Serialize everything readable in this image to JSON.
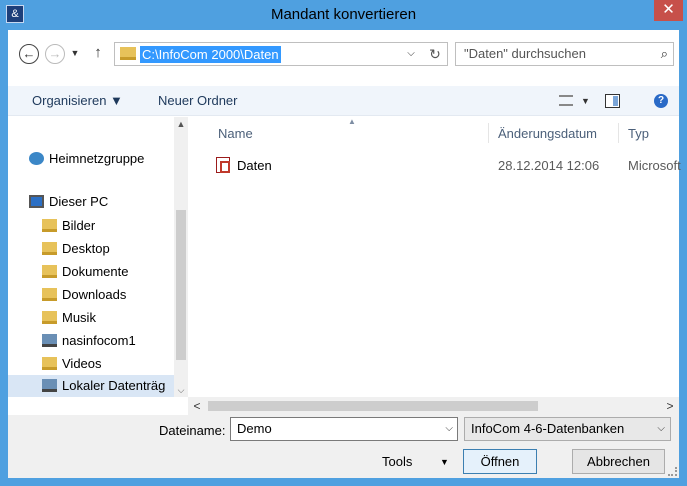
{
  "window": {
    "title": "Mandant konvertieren",
    "app_icon": "infocom-app-icon",
    "close": "✕"
  },
  "nav": {
    "back": "←",
    "forward": "→",
    "recent": "▼",
    "up": "↑",
    "address": "C:\\InfoCom 2000\\Daten",
    "address_dropdown": "⌵",
    "refresh": "↻",
    "search_placeholder": "\"Daten\" durchsuchen",
    "search_icon": "⌕"
  },
  "toolbar": {
    "organize": "Organisieren ▼",
    "new_folder": "Neuer Ordner",
    "view_dropdown": "▼",
    "help": "?"
  },
  "sidebar": {
    "scroll_up": "▲",
    "scroll_down": "⌵",
    "items": [
      {
        "label": "Heimnetzgruppe",
        "icon": "homegroup-icon"
      },
      {
        "label": "Dieser PC",
        "icon": "pc-icon"
      },
      {
        "label": "Bilder",
        "icon": "folder-pictures-icon"
      },
      {
        "label": "Desktop",
        "icon": "folder-desktop-icon"
      },
      {
        "label": "Dokumente",
        "icon": "folder-documents-icon"
      },
      {
        "label": "Downloads",
        "icon": "folder-downloads-icon"
      },
      {
        "label": "Musik",
        "icon": "folder-music-icon"
      },
      {
        "label": "nasinfocom1",
        "icon": "network-drive-icon"
      },
      {
        "label": "Videos",
        "icon": "folder-videos-icon"
      },
      {
        "label": "Lokaler Datenträg",
        "icon": "local-drive-icon"
      }
    ]
  },
  "columns": {
    "name": "Name",
    "modified": "Änderungsdatum",
    "type": "Typ",
    "sort_indicator": "▲"
  },
  "files": [
    {
      "name": "Daten",
      "modified": "28.12.2014 12:06",
      "type": "Microsoft",
      "icon": "access-db-icon"
    }
  ],
  "hscroll": {
    "left": "<",
    "right": ">"
  },
  "bottom": {
    "filename_label": "Dateiname:",
    "filename_value": "Demo",
    "filename_dropdown": "⌵",
    "filter_value": "InfoCom 4-6-Datenbanken",
    "filter_dropdown": "⌵",
    "tools_label": "Tools",
    "tools_arrow": "▼",
    "open_label": "Öffnen",
    "cancel_label": "Abbrechen"
  }
}
